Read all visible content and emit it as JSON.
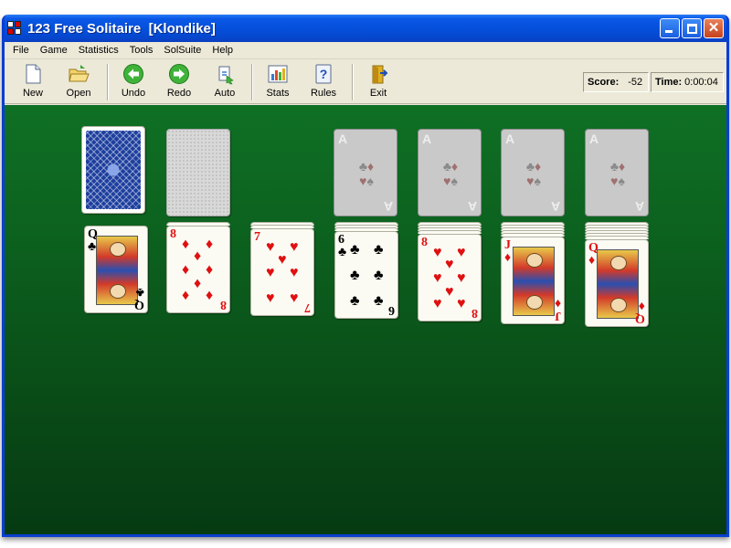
{
  "window": {
    "title": "123 Free Solitaire  [Klondike]"
  },
  "menu": [
    "File",
    "Game",
    "Statistics",
    "Tools",
    "SolSuite",
    "Help"
  ],
  "toolbar": {
    "new": "New",
    "open": "Open",
    "undo": "Undo",
    "redo": "Redo",
    "auto": "Auto",
    "stats": "Stats",
    "rules": "Rules",
    "exit": "Exit"
  },
  "status": {
    "score_label": "Score:",
    "score_value": "-52",
    "time_label": "Time:",
    "time_value": "0:00:04"
  },
  "foundation": {
    "ace_label": "A",
    "suits": [
      "♣",
      "♦",
      "♥",
      "♠"
    ]
  },
  "tableau": [
    {
      "rank": "Q",
      "suit": "♣",
      "color": "black"
    },
    {
      "rank": "8",
      "suit": "♦",
      "color": "red"
    },
    {
      "rank": "7",
      "suit": "♥",
      "color": "red"
    },
    {
      "rank": "6",
      "suit": "♣",
      "color": "black"
    },
    {
      "rank": "8",
      "suit": "♥",
      "color": "red"
    },
    {
      "rank": "J",
      "suit": "♦",
      "color": "red"
    },
    {
      "rank": "Q",
      "suit": "♦",
      "color": "red"
    }
  ],
  "colors": {
    "felt": "#0c5f1e",
    "titlebar": "#0550dc",
    "red_suit": "#e01010",
    "card_back": "#1e3f9e"
  },
  "icons": [
    "new-icon",
    "open-icon",
    "undo-icon",
    "redo-icon",
    "auto-icon",
    "stats-icon",
    "rules-icon",
    "exit-icon"
  ]
}
